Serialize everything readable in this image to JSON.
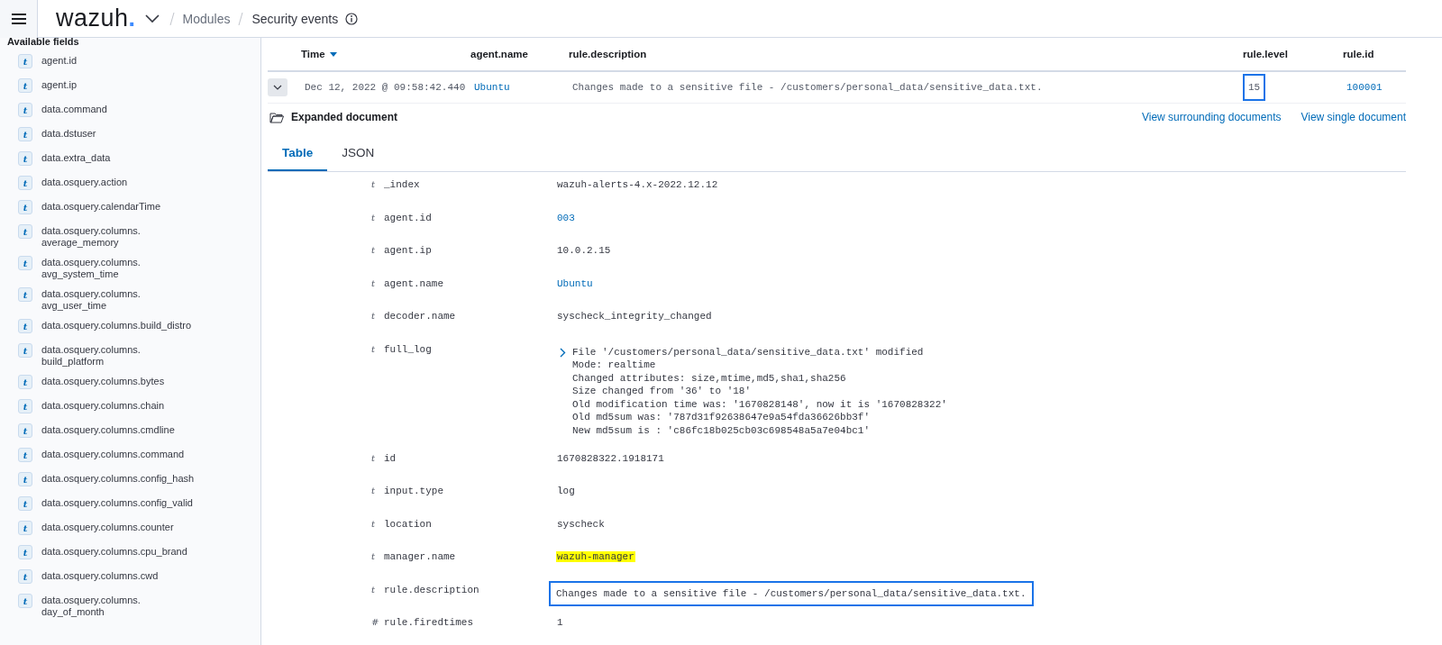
{
  "header": {
    "logo": {
      "text": "wazuh",
      "dot": "."
    },
    "breadcrumbs": [
      {
        "label": "Modules",
        "current": false
      },
      {
        "label": "Security events",
        "current": true
      }
    ]
  },
  "sidebar": {
    "title": "Available fields",
    "items": [
      {
        "type": "t",
        "label": "agent.id"
      },
      {
        "type": "t",
        "label": "agent.ip"
      },
      {
        "type": "t",
        "label": "data.command"
      },
      {
        "type": "t",
        "label": "data.dstuser"
      },
      {
        "type": "t",
        "label": "data.extra_data"
      },
      {
        "type": "t",
        "label": "data.osquery.action"
      },
      {
        "type": "t",
        "label": "data.osquery.calendarTime"
      },
      {
        "type": "t",
        "label": "data.osquery.columns.",
        "label_2": "average_memory"
      },
      {
        "type": "t",
        "label": "data.osquery.columns.",
        "label_2": "avg_system_time"
      },
      {
        "type": "t",
        "label": "data.osquery.columns.",
        "label_2": "avg_user_time"
      },
      {
        "type": "t",
        "label": "data.osquery.columns.build_distro"
      },
      {
        "type": "t",
        "label": "data.osquery.columns.",
        "label_2": "build_platform"
      },
      {
        "type": "t",
        "label": "data.osquery.columns.bytes"
      },
      {
        "type": "t",
        "label": "data.osquery.columns.chain"
      },
      {
        "type": "t",
        "label": "data.osquery.columns.cmdline"
      },
      {
        "type": "t",
        "label": "data.osquery.columns.command"
      },
      {
        "type": "t",
        "label": "data.osquery.columns.config_hash"
      },
      {
        "type": "t",
        "label": "data.osquery.columns.config_valid"
      },
      {
        "type": "t",
        "label": "data.osquery.columns.counter"
      },
      {
        "type": "t",
        "label": "data.osquery.columns.cpu_brand"
      },
      {
        "type": "t",
        "label": "data.osquery.columns.cwd"
      },
      {
        "type": "t",
        "label": "data.osquery.columns.",
        "label_2": "day_of_month"
      }
    ]
  },
  "table": {
    "columns": [
      {
        "label": "Time",
        "sorted": true
      },
      {
        "label": "agent.name",
        "sorted": false
      },
      {
        "label": "rule.description",
        "sorted": false
      },
      {
        "label": "rule.level",
        "sorted": false
      },
      {
        "label": "rule.id",
        "sorted": false
      }
    ],
    "row": {
      "expanded": true,
      "cells": [
        {
          "text": "Dec 12, 2022 @ 09:58:42.440",
          "link": false,
          "outlined": false
        },
        {
          "text": "Ubuntu",
          "link": true,
          "outlined": false
        },
        {
          "text": "Changes made to a sensitive file - /customers/personal_data/sensitive_data.txt.",
          "link": false,
          "outlined": false
        },
        {
          "text": "15",
          "link": false,
          "outlined": true
        },
        {
          "text": "100001",
          "link": true,
          "outlined": false
        }
      ]
    }
  },
  "expanded_document": {
    "title": "Expanded document",
    "links": [
      "View surrounding documents",
      "View single document"
    ],
    "tabs": [
      {
        "label": "Table",
        "selected": true
      },
      {
        "label": "JSON",
        "selected": false
      }
    ],
    "fields": [
      {
        "type": "t",
        "name": "_index",
        "value": "wazuh-alerts-4.x-2022.12.12",
        "link": false,
        "highlighted": false,
        "outlined": false
      },
      {
        "type": "t",
        "name": "agent.id",
        "value": "003",
        "link": true,
        "highlighted": false,
        "outlined": false
      },
      {
        "type": "t",
        "name": "agent.ip",
        "value": "10.0.2.15",
        "link": false,
        "highlighted": false,
        "outlined": false
      },
      {
        "type": "t",
        "name": "agent.name",
        "value": "Ubuntu",
        "link": true,
        "highlighted": false,
        "outlined": false
      },
      {
        "type": "t",
        "name": "decoder.name",
        "value": "syscheck_integrity_changed",
        "link": false,
        "highlighted": false,
        "outlined": false
      },
      {
        "type": "t",
        "name": "full_log",
        "lines": [
          "File '/customers/personal_data/sensitive_data.txt' modified",
          "Mode: realtime",
          "Changed attributes: size,mtime,md5,sha1,sha256",
          "Size changed from '36' to '18'",
          "Old modification time was: '1670828148', now it is '1670828322'",
          "Old md5sum was: '787d31f92638647e9a54fda36626bb3f'",
          "New md5sum is : 'c86fc18b025cb03c698548a5a7e04bc1'"
        ]
      },
      {
        "type": "t",
        "name": "id",
        "value": "1670828322.1918171",
        "link": false,
        "highlighted": false,
        "outlined": false
      },
      {
        "type": "t",
        "name": "input.type",
        "value": "log",
        "link": false,
        "highlighted": false,
        "outlined": false
      },
      {
        "type": "t",
        "name": "location",
        "value": "syscheck",
        "link": false,
        "highlighted": false,
        "outlined": false
      },
      {
        "type": "t",
        "name": "manager.name",
        "value": "wazuh-manager",
        "link": false,
        "highlighted": true,
        "outlined": false
      },
      {
        "type": "t",
        "name": "rule.description",
        "value": "Changes made to a sensitive file - /customers/personal_data/sensitive_data.txt.",
        "link": false,
        "highlighted": false,
        "outlined": true
      },
      {
        "type": "#",
        "name": "rule.firedtimes",
        "value": "1",
        "link": false,
        "highlighted": false,
        "outlined": false
      }
    ]
  }
}
